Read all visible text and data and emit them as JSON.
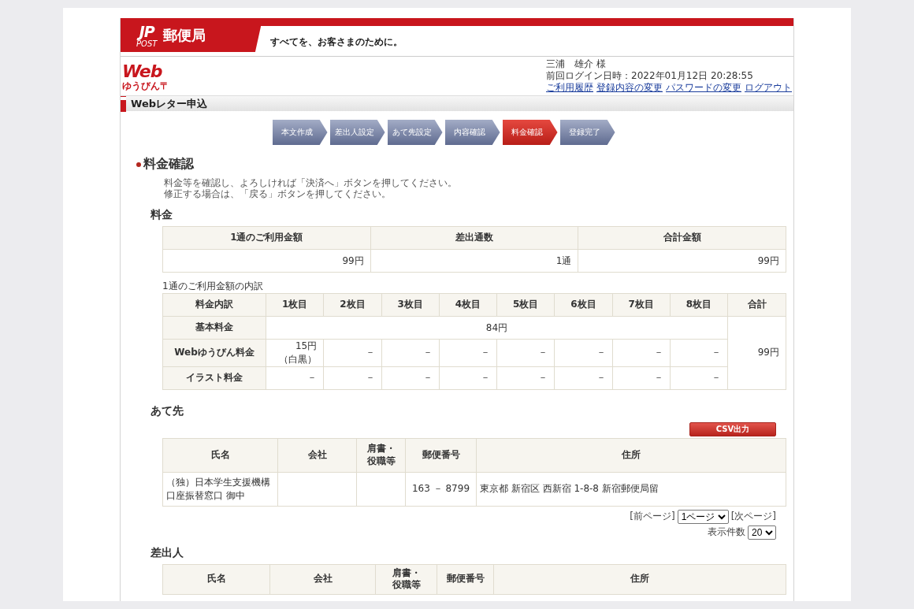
{
  "header": {
    "logo_mark": "JP",
    "logo_sub": "POST",
    "logo_name": "郵便局",
    "tagline": "すべてを、お客さまのために。"
  },
  "service_logo": {
    "title": "Web",
    "subtitle": "ゆうびん〒"
  },
  "user": {
    "name": "三浦　雄介 様",
    "last_login": "前回ログイン日時：2022年01月12日 20:28:55",
    "links": [
      "ご利用履歴",
      "登録内容の変更",
      "パスワードの変更",
      "ログアウト"
    ]
  },
  "section_bar": {
    "title": "Webレター申込"
  },
  "steps": [
    {
      "label": "本文作成",
      "selected": false
    },
    {
      "label": "差出人設定",
      "selected": false
    },
    {
      "label": "あて先設定",
      "selected": false
    },
    {
      "label": "内容確認",
      "selected": false
    },
    {
      "label": "料金確認",
      "selected": true
    },
    {
      "label": "登録完了",
      "selected": false
    }
  ],
  "page_title": "料金確認",
  "instructions": [
    "料金等を確認し、よろしければ「決済へ」ボタンを押してください。",
    "修正する場合は、「戻る」ボタンを押してください。"
  ],
  "fee": {
    "title": "料金",
    "columns": [
      "1通のご利用金額",
      "差出通数",
      "合計金額"
    ],
    "values": [
      "99円",
      "1通",
      "99円"
    ]
  },
  "breakdown": {
    "caption": "1通のご利用金額の内訳",
    "columns": [
      "料金内訳",
      "1枚目",
      "2枚目",
      "3枚目",
      "4枚目",
      "5枚目",
      "6枚目",
      "7枚目",
      "8枚目",
      "合計"
    ],
    "rows": [
      [
        {
          "text": "基本料金"
        },
        {
          "text": "84円",
          "colspan": 8
        },
        {
          "text": "99円",
          "rowspan": 3
        }
      ],
      [
        {
          "text": "Webゆうびん料金"
        },
        {
          "text": "15円（白黒）"
        },
        {
          "text": "－"
        },
        {
          "text": "－"
        },
        {
          "text": "－"
        },
        {
          "text": "－"
        },
        {
          "text": "－"
        },
        {
          "text": "－"
        },
        {
          "text": "－"
        }
      ],
      [
        {
          "text": "イラスト料金"
        },
        {
          "text": "－"
        },
        {
          "text": "－"
        },
        {
          "text": "－"
        },
        {
          "text": "－"
        },
        {
          "text": "－"
        },
        {
          "text": "－"
        },
        {
          "text": "－"
        },
        {
          "text": "－"
        }
      ]
    ]
  },
  "recipients": {
    "title": "あて先",
    "csv_button": "CSV出力",
    "columns": [
      "氏名",
      "会社",
      "肩書・役職等",
      "郵便番号",
      "住所"
    ],
    "rows": [
      [
        "（独）日本学生支援機構口座振替窓口 御中",
        "",
        "",
        "163 － 8799",
        "東京都 新宿区 西新宿 1-8-8 新宿郵便局留"
      ]
    ],
    "pager": {
      "prev": "[前ページ]",
      "page": "1ページ",
      "next": "[次ページ]",
      "count_label": "表示件数",
      "count": "20"
    }
  },
  "sender": {
    "title": "差出人",
    "columns": [
      "氏名",
      "会社",
      "肩書・役職等",
      "郵便番号",
      "住所"
    ]
  }
}
